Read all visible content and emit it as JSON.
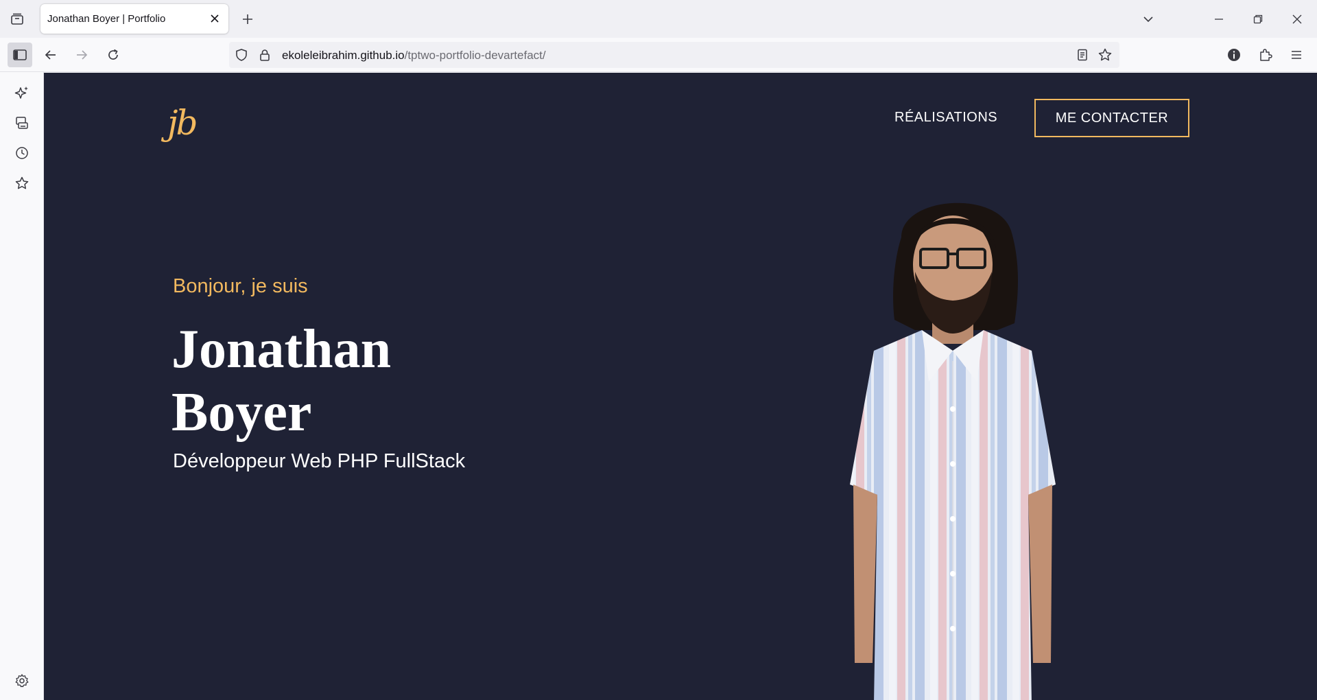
{
  "browser": {
    "tab_title": "Jonathan Boyer | Portfolio",
    "url_host": "ekoleleibrahim.github.io",
    "url_path": "/tptwo-portfolio-devartefact/"
  },
  "icons": {
    "list_all_tabs": "list-all-tabs-icon",
    "tab_close": "close-icon",
    "new_tab": "plus-icon",
    "dropdown": "chevron-down-icon",
    "minimize": "minimize-icon",
    "restore": "restore-icon",
    "window_close": "close-icon",
    "sidebar_toggle": "sidebar-icon",
    "back": "arrow-left-icon",
    "forward": "arrow-right-icon",
    "reload": "reload-icon",
    "shield": "shield-icon",
    "lock": "lock-icon",
    "reader": "reader-view-icon",
    "bookmark": "star-icon",
    "info": "info-icon",
    "extensions": "puzzle-icon",
    "menu": "hamburger-menu-icon",
    "ai": "sparkle-icon",
    "synced_tabs": "synced-tabs-icon",
    "history": "clock-icon",
    "bookmarks": "star-icon",
    "settings": "gear-icon"
  },
  "site": {
    "logo": "jb",
    "nav": {
      "realisations": "RÉALISATIONS",
      "contact": "ME CONTACTER"
    },
    "hero": {
      "greeting": "Bonjour, je suis",
      "first_name": "Jonathan",
      "last_name": "Boyer",
      "role": "Développeur Web PHP FullStack"
    }
  },
  "colors": {
    "page_background": "#1f2235",
    "accent": "#f2b95f",
    "text": "#ffffff"
  }
}
